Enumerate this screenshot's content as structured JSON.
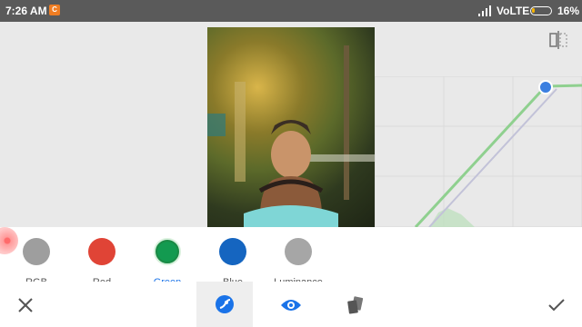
{
  "status_bar": {
    "time": "7:26 AM",
    "notification_icon": "C",
    "network": "VoLTE",
    "battery_percent": "16%",
    "battery_level": 0.16
  },
  "editor": {
    "photo_description_icon": "photo",
    "compare_icon": "split-compare-icon"
  },
  "channels": [
    {
      "label": "RGB",
      "color": "#9e9e9e",
      "active": false
    },
    {
      "label": "Red",
      "color": "#e04436",
      "active": false
    },
    {
      "label": "Green",
      "color": "#139a50",
      "active": true
    },
    {
      "label": "Blue",
      "color": "#1565c0",
      "active": false
    },
    {
      "label": "Luminance",
      "color": "#a6a6a6",
      "active": false
    }
  ],
  "toolbar": {
    "cancel_icon": "close-icon",
    "curves_icon": "curves-tool-icon",
    "preview_icon": "eye-icon",
    "styles_icon": "presets-icon",
    "apply_icon": "check-icon"
  },
  "colors": {
    "accent": "#1a73e8",
    "green_curve": "#8fd08f",
    "panel_bg": "#ffffff",
    "editor_bg": "#e9e9e9"
  }
}
